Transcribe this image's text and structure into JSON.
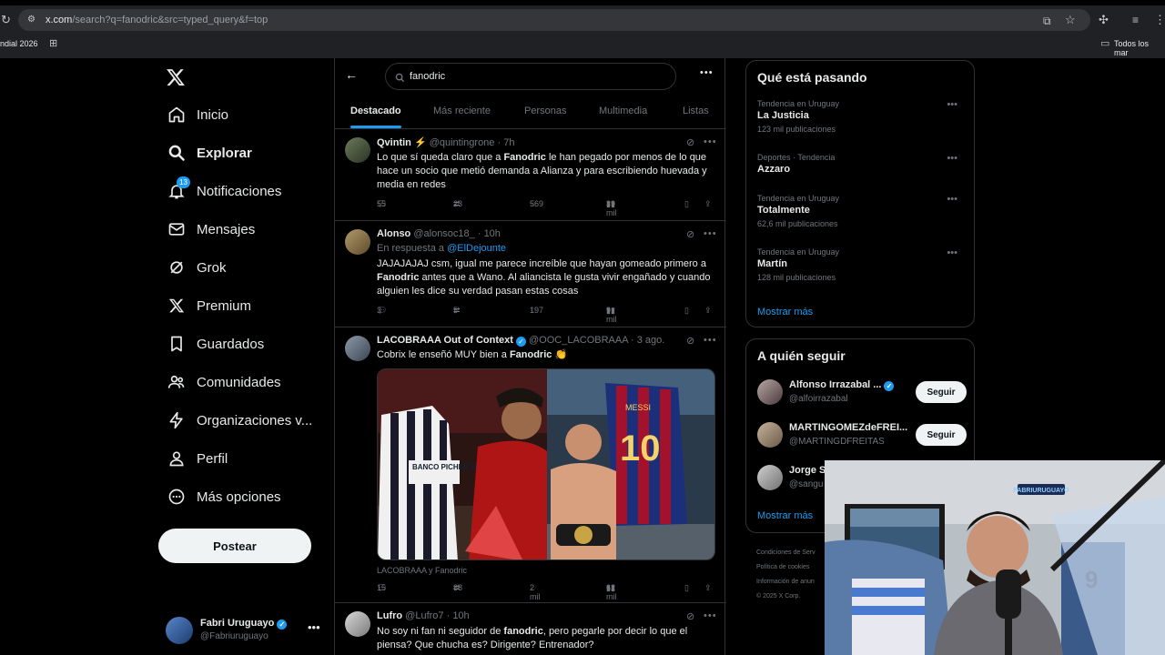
{
  "browser": {
    "url_host": "x.com",
    "url_path": "/search?q=fanodric&src=typed_query&f=top",
    "bookmark_left": "ndial 2026",
    "bookmark_right": "Todos los mar"
  },
  "nav": {
    "items": [
      {
        "label": "Inicio",
        "icon": "home-icon"
      },
      {
        "label": "Explorar",
        "icon": "search-icon"
      },
      {
        "label": "Notificaciones",
        "icon": "bell-icon",
        "badge": "13"
      },
      {
        "label": "Mensajes",
        "icon": "mail-icon"
      },
      {
        "label": "Grok",
        "icon": "grok-icon"
      },
      {
        "label": "Premium",
        "icon": "x-logo-icon"
      },
      {
        "label": "Guardados",
        "icon": "bookmark-icon"
      },
      {
        "label": "Comunidades",
        "icon": "people-icon"
      },
      {
        "label": "Organizaciones v...",
        "icon": "lightning-icon"
      },
      {
        "label": "Perfil",
        "icon": "person-icon"
      },
      {
        "label": "Más opciones",
        "icon": "more-circle-icon"
      }
    ],
    "post_label": "Postear",
    "account": {
      "name": "Fabri Uruguayo",
      "handle": "@Fabriuruguayo"
    }
  },
  "search": {
    "query": "fanodric"
  },
  "tabs": [
    "Destacado",
    "Más reciente",
    "Personas",
    "Multimedia",
    "Listas"
  ],
  "posts": [
    {
      "name": "Qvintin ⚡",
      "handle": "@quintingrone",
      "time": "· 7h",
      "reply_to": "",
      "text_before": "Lo que sí queda claro que a ",
      "text_bold": "Fanodric",
      "text_after": " le han pegado por menos de lo que hace un socio que metió demanda a Alianza y para escribiendo huevada y media en redes",
      "replies": "55",
      "reposts": "23",
      "likes": "569",
      "views": "39 mil"
    },
    {
      "name": "Alonso",
      "handle": "@alonsoc18_",
      "time": "· 10h",
      "reply_to_label": "En respuesta a ",
      "reply_to": "@ElDejounte",
      "text_before": "JAJAJAJAJ csm, igual me parece increíble que hayan gomeado primero a ",
      "text_bold": "Fanodric",
      "text_after": " antes que a Wano. Al aliancista le gusta vivir engañado y cuando alguien les dice su verdad pasan estas cosas",
      "replies": "3",
      "reposts": "5",
      "likes": "197",
      "views": "9 mil"
    },
    {
      "name": "LACOBRAAA Out of Context",
      "handle": "@OOC_LACOBRAAA",
      "time": "· 3 ago.",
      "text_before": "Cobrix le enseñó MUY bien a ",
      "text_bold": "Fanodric",
      "text_after": " 👏",
      "image_caption": "LACOBRAAA y Fanodric",
      "image_texts": {
        "sponsor": "BANCO PICHINCHA",
        "jersey_name": "MESSI",
        "jersey_number": "10"
      },
      "replies": "15",
      "reposts": "88",
      "likes": "2 mil",
      "views": "62 mil"
    },
    {
      "name": "Lufro",
      "handle": "@Lufro7",
      "time": "· 10h",
      "text_before": "No soy ni fan ni seguidor de ",
      "text_bold": "fanodric",
      "text_after": ", pero pegarle por decir lo que el piensa? Que chucha es? Dirigente? Entrenador?"
    }
  ],
  "trends": {
    "title": "Qué está pasando",
    "items": [
      {
        "meta": "Tendencia en Uruguay",
        "name": "La Justicia",
        "count": "123 mil publicaciones"
      },
      {
        "meta": "Deportes · Tendencia",
        "name": "Azzaro",
        "count": ""
      },
      {
        "meta": "Tendencia en Uruguay",
        "name": "Totalmente",
        "count": "62,6 mil publicaciones"
      },
      {
        "meta": "Tendencia en Uruguay",
        "name": "Martín",
        "count": "128 mil publicaciones"
      }
    ],
    "show_more": "Mostrar más"
  },
  "who_to_follow": {
    "title": "A quién seguir",
    "items": [
      {
        "name": "Alfonso Irrazabal ...",
        "handle": "@alfoirrazabal",
        "follow": "Seguir"
      },
      {
        "name": "MARTINGOMEZdeFREI...",
        "handle": "@MARTINGDFREITAS",
        "follow": "Seguir"
      },
      {
        "name": "Jorge S",
        "handle": "@sangu"
      }
    ],
    "show_more": "Mostrar más"
  },
  "footer": [
    "Condiciones de Serv",
    "Política de cookies",
    "Información de anun",
    "© 2025 X Corp."
  ],
  "webcam": {
    "sign": "FABRIURUGUAYO",
    "jersey_number": "9"
  },
  "colors": {
    "accent": "#1d9bf0",
    "background": "#000000",
    "border": "#2f3336",
    "muted": "#71767b"
  }
}
